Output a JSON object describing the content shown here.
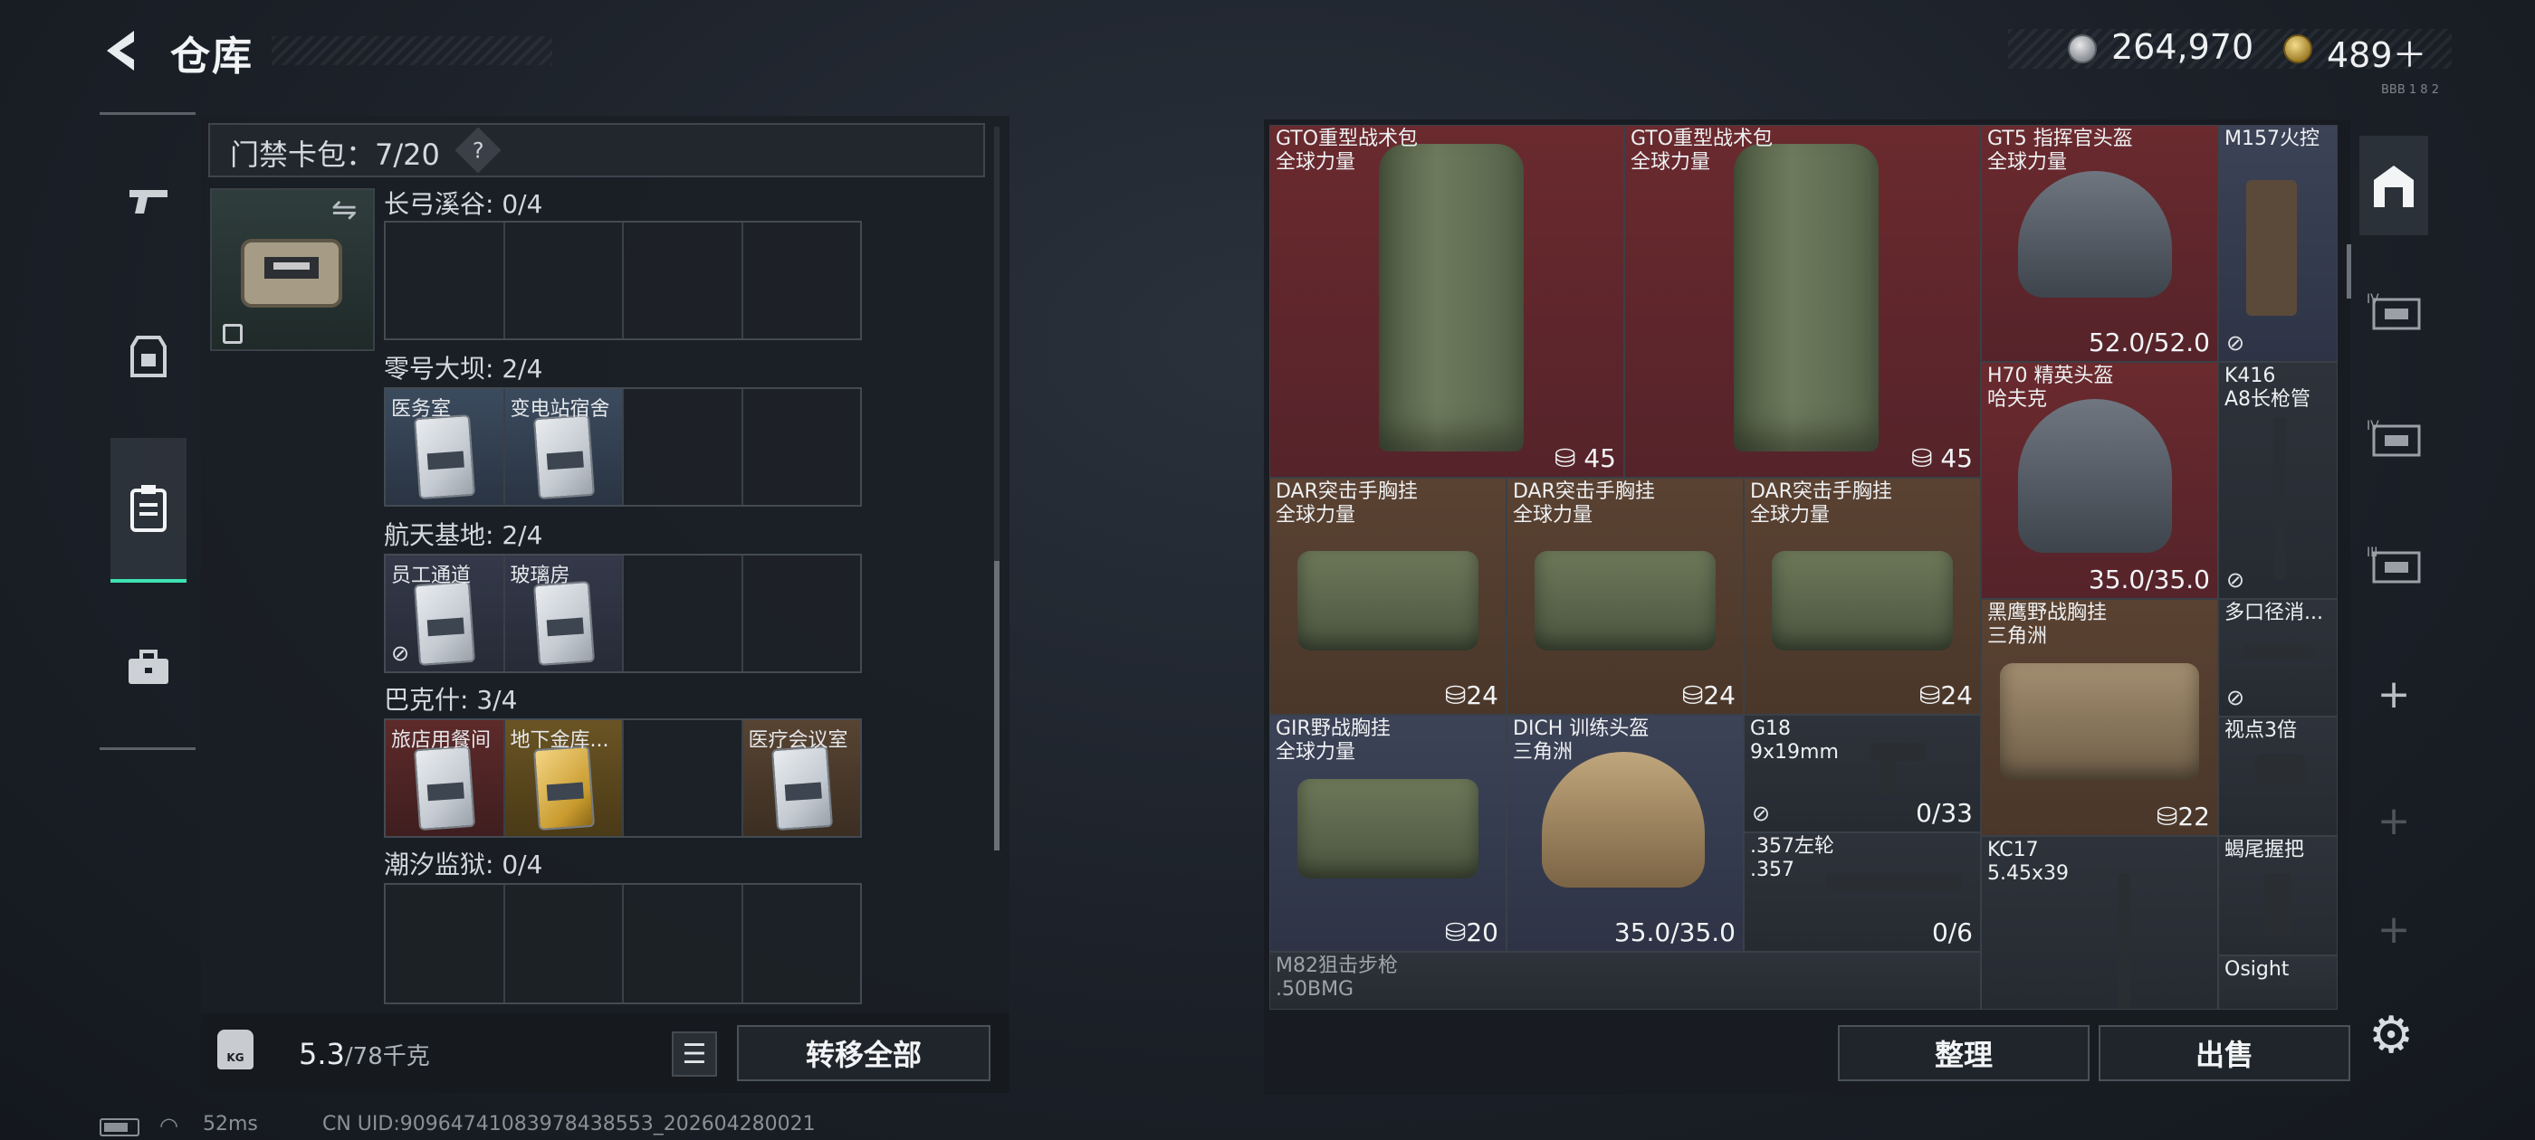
{
  "header": {
    "title": "仓库",
    "silver_amount": "264,970",
    "gold_amount": "489＋",
    "code_small": "BBB 1 8 2"
  },
  "left_nav": {
    "items": [
      {
        "name": "weapon",
        "icon": "pistol-icon"
      },
      {
        "name": "equipment",
        "icon": "vest-icon"
      },
      {
        "name": "keybag",
        "icon": "keycard-bag-icon",
        "active": true
      },
      {
        "name": "toolbox",
        "icon": "toolbox-icon"
      }
    ]
  },
  "keybag": {
    "label": "门禁卡包：7/20",
    "help": "?",
    "maps": [
      {
        "title": "长弓溪谷: 0/4",
        "slots": [
          {
            "label": ""
          },
          {
            "label": ""
          },
          {
            "label": ""
          },
          {
            "label": ""
          }
        ]
      },
      {
        "title": "零号大坝: 2/4",
        "slots": [
          {
            "label": "医务室",
            "color": "blue"
          },
          {
            "label": "变电站宿舍",
            "color": "blue"
          },
          {
            "label": ""
          },
          {
            "label": ""
          }
        ]
      },
      {
        "title": "航天基地: 2/4",
        "slots": [
          {
            "label": "员工通道",
            "color": "slate"
          },
          {
            "label": "玻璃房",
            "color": "slate"
          },
          {
            "label": ""
          },
          {
            "label": ""
          }
        ]
      },
      {
        "title": "巴克什: 3/4",
        "slots": [
          {
            "label": "旅店用餐间",
            "color": "red"
          },
          {
            "label": "地下金库...",
            "color": "gold"
          },
          {
            "label": ""
          },
          {
            "label": "医疗会议室",
            "color": "brown"
          }
        ]
      },
      {
        "title": "潮汐监狱: 0/4",
        "slots": [
          {
            "label": ""
          },
          {
            "label": ""
          },
          {
            "label": ""
          },
          {
            "label": ""
          }
        ]
      }
    ]
  },
  "weight": {
    "current": "5.3",
    "max": "/78千克",
    "icon_label": "KG"
  },
  "buttons": {
    "transfer_all": "转移全部",
    "sort": "整理",
    "sell": "出售"
  },
  "items": [
    {
      "name": "GTO重型战术包",
      "sub": "全球力量",
      "stat": "45",
      "bg": "red"
    },
    {
      "name": "GTO重型战术包",
      "sub": "全球力量",
      "stat": "45",
      "bg": "red"
    },
    {
      "name": "GT5 指挥官头盔",
      "sub": "全球力量",
      "stat": "52.0/52.0",
      "bg": "red"
    },
    {
      "name": "M157火控",
      "sub": "",
      "stat": "",
      "bg": "blue"
    },
    {
      "name": "H70 精英头盔",
      "sub": "哈夫克",
      "stat": "35.0/35.0",
      "bg": "red"
    },
    {
      "name": "K416",
      "sub": "A8长枪管",
      "stat": "",
      "bg": "slate"
    },
    {
      "name": "DAR突击手胸挂",
      "sub": "全球力量",
      "stat": "24",
      "bg": "brown"
    },
    {
      "name": "DAR突击手胸挂",
      "sub": "全球力量",
      "stat": "24",
      "bg": "brown"
    },
    {
      "name": "DAR突击手胸挂",
      "sub": "全球力量",
      "stat": "24",
      "bg": "brown"
    },
    {
      "name": "黑鹰野战胸挂",
      "sub": "三角洲",
      "stat": "22",
      "bg": "brown"
    },
    {
      "name": "多口径消...",
      "sub": "",
      "stat": "",
      "bg": "slate"
    },
    {
      "name": "GIR野战胸挂",
      "sub": "全球力量",
      "stat": "20",
      "bg": "blue"
    },
    {
      "name": "DICH 训练头盔",
      "sub": "三角洲",
      "stat": "35.0/35.0",
      "bg": "blue"
    },
    {
      "name": "G18",
      "sub": "9x19mm",
      "stat": "0/33",
      "bg": "slate"
    },
    {
      "name": "视点3倍",
      "sub": "",
      "stat": "",
      "bg": "slate"
    },
    {
      "name": ".357左轮",
      "sub": ".357",
      "stat": "0/6",
      "bg": "slate"
    },
    {
      "name": "KC17",
      "sub": "5.45x39",
      "stat": "",
      "bg": "slate"
    },
    {
      "name": "蝎尾握把",
      "sub": "",
      "stat": "",
      "bg": "slate"
    },
    {
      "name": "M82狙击步枪",
      "sub": ".50BMG",
      "stat": "",
      "bg": "slate"
    },
    {
      "name": "Osight",
      "sub": "",
      "stat": "",
      "bg": "slate"
    }
  ],
  "side_tabs": {
    "tier_labels": [
      "IV",
      "IV",
      "III"
    ]
  },
  "status": {
    "ping": "52ms",
    "uid": "CN UID:90964741083978438553_202604280021"
  }
}
